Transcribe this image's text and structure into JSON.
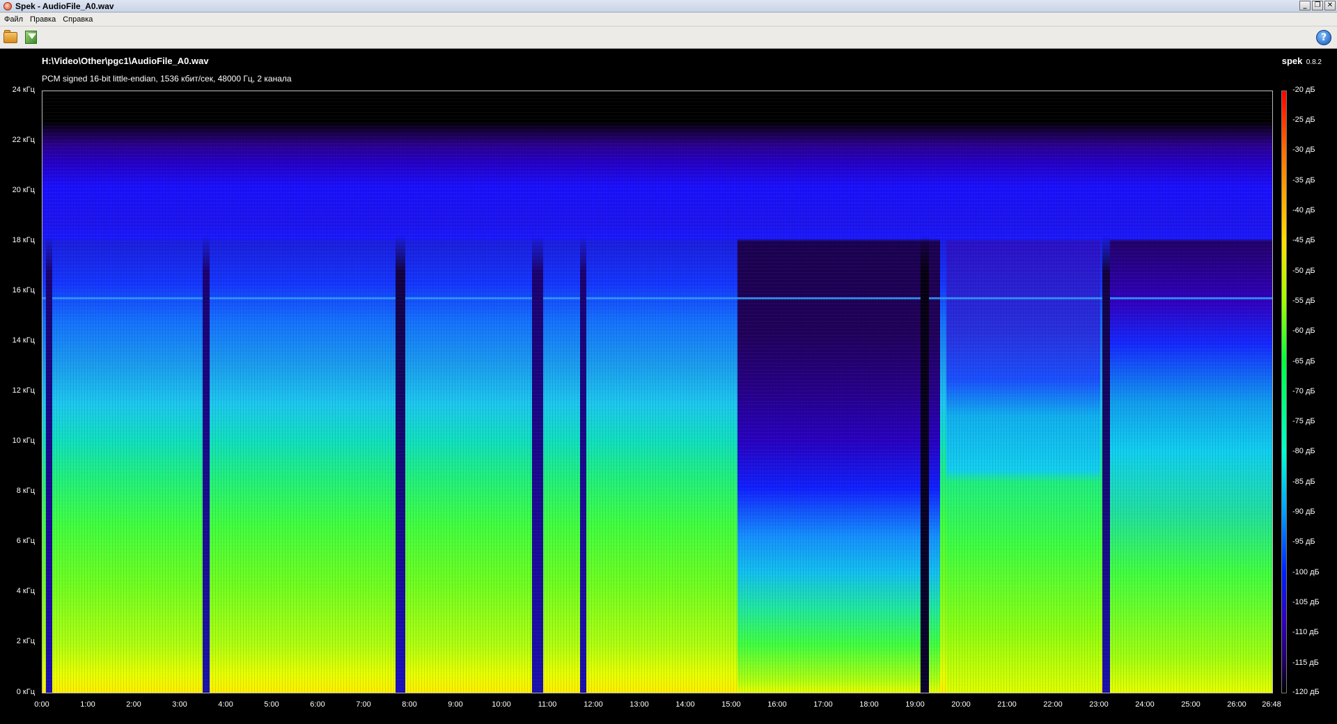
{
  "window": {
    "title": "Spek - AudioFile_A0.wav",
    "buttons": {
      "minimize": "_",
      "restore": "❐",
      "close": "✕"
    }
  },
  "menu": [
    "Файл",
    "Правка",
    "Справка"
  ],
  "toolbar": {
    "open_icon": "folder-open-icon",
    "save_icon": "save-image-icon",
    "help_icon": "help-icon",
    "help_glyph": "?"
  },
  "header": {
    "file_path": "H:\\Video\\Other\\pgc1\\AudioFile_A0.wav",
    "file_info": "PCM signed 16-bit little-endian, 1536 кбит/сек, 48000 Гц, 2 канала",
    "brand_name": "spek",
    "brand_version": "0.8.2"
  },
  "axes": {
    "frequency_labels": [
      "24 кГц",
      "22 кГц",
      "20 кГц",
      "18 кГц",
      "16 кГц",
      "14 кГц",
      "12 кГц",
      "10 кГц",
      "8 кГц",
      "6 кГц",
      "4 кГц",
      "2 кГц",
      "0 кГц"
    ],
    "time_labels": [
      "0:00",
      "1:00",
      "2:00",
      "3:00",
      "4:00",
      "5:00",
      "6:00",
      "7:00",
      "8:00",
      "9:00",
      "10:00",
      "11:00",
      "12:00",
      "13:00",
      "14:00",
      "15:00",
      "16:00",
      "17:00",
      "18:00",
      "19:00",
      "20:00",
      "21:00",
      "22:00",
      "23:00",
      "24:00",
      "25:00",
      "26:00",
      "26:48"
    ],
    "db_labels": [
      "-20 дБ",
      "-25 дБ",
      "-30 дБ",
      "-35 дБ",
      "-40 дБ",
      "-45 дБ",
      "-50 дБ",
      "-55 дБ",
      "-60 дБ",
      "-65 дБ",
      "-70 дБ",
      "-75 дБ",
      "-80 дБ",
      "-85 дБ",
      "-90 дБ",
      "-95 дБ",
      "-100 дБ",
      "-105 дБ",
      "-110 дБ",
      "-115 дБ",
      "-120 дБ"
    ]
  },
  "colors": {
    "background": "#000000",
    "titlebar": "#c8d3e6",
    "menubar": "#ecebe7"
  }
}
